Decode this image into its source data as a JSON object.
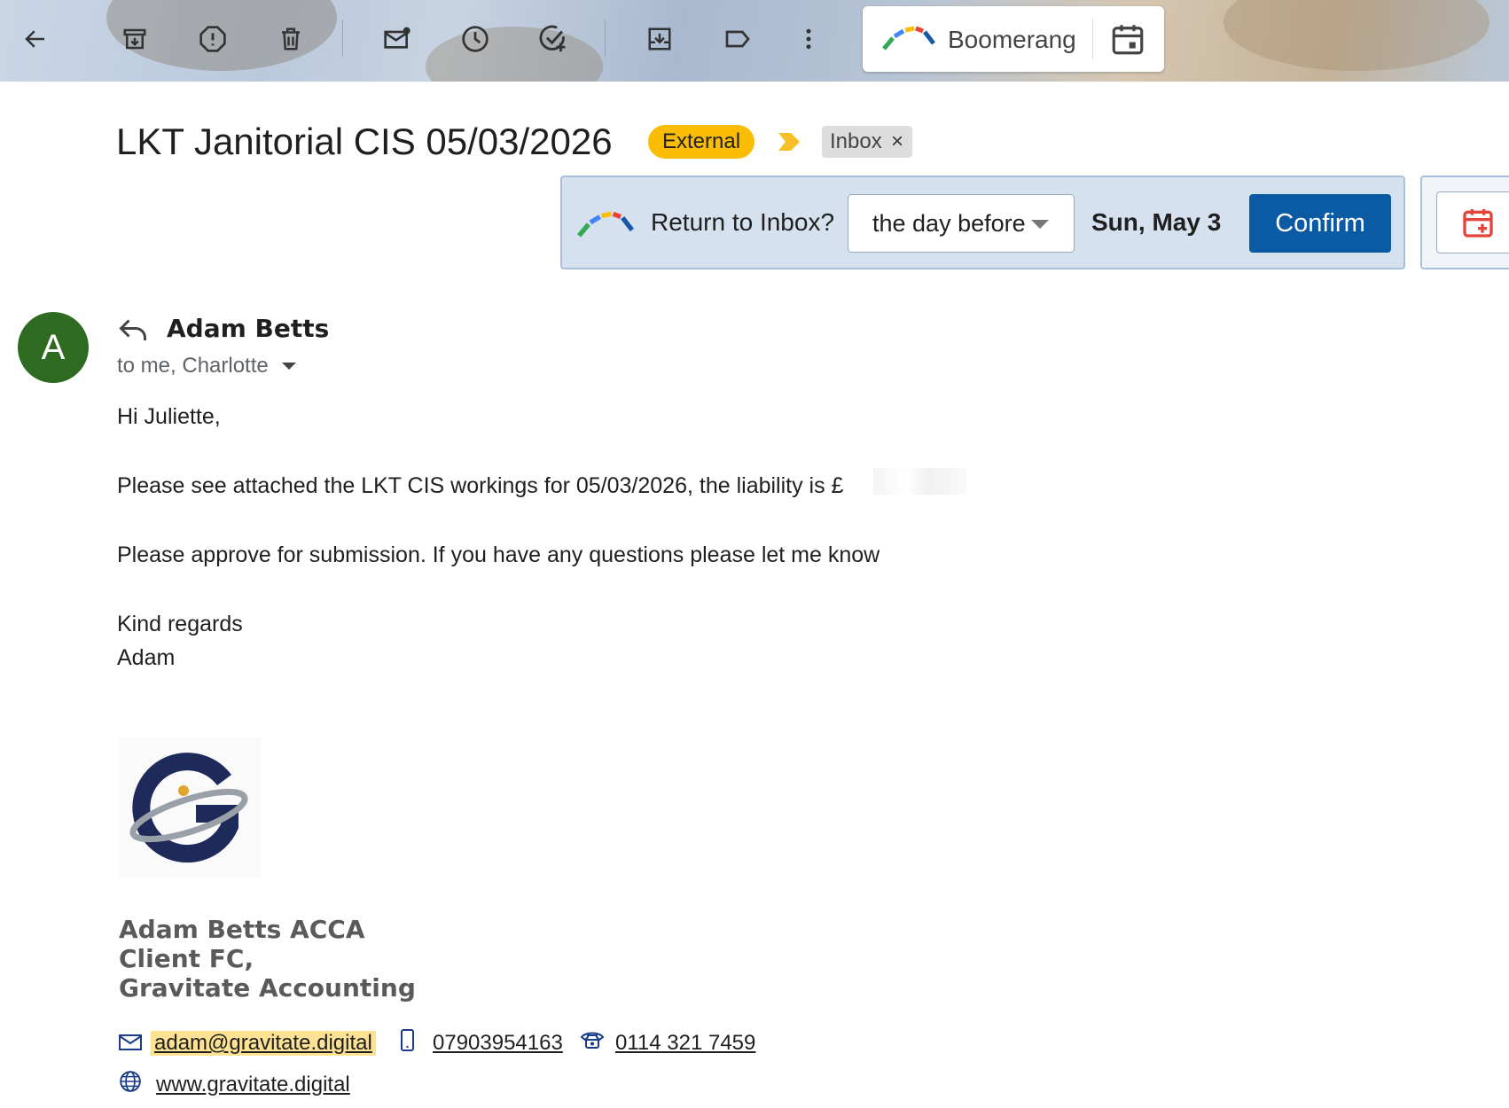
{
  "toolbar": {
    "icons": [
      "back-arrow-icon",
      "archive-icon",
      "report-spam-icon",
      "delete-icon",
      "mark-unread-icon",
      "snooze-icon",
      "add-to-tasks-icon",
      "move-to-icon",
      "label-icon",
      "more-vert-icon"
    ],
    "boomerang_label": "Boomerang"
  },
  "subject": {
    "title": "LKT Janitorial CIS 05/03/2026",
    "external_badge": "External",
    "inbox_label": "Inbox",
    "inbox_remove": "×"
  },
  "boomerang_bar": {
    "question": "Return to Inbox?",
    "selected_option": "the day before",
    "date": "Sun, May 3",
    "confirm_label": "Confirm"
  },
  "message": {
    "avatar_letter": "A",
    "sender": "Adam Betts",
    "recipients": "to me, Charlotte",
    "body": {
      "greeting": "Hi Juliette,",
      "line1": "Please see attached the LKT CIS workings for 05/03/2026, the liability is £",
      "line2": "Please approve for submission. If you have any questions please let me know",
      "closing": "Kind regards",
      "signoff": "Adam"
    }
  },
  "signature": {
    "name": "Adam Betts ACCA",
    "role": "Client FC,",
    "company": "Gravitate Accounting",
    "email": "adam@gravitate.digital",
    "mobile": "07903954163",
    "phone": "0114 321 7459",
    "website": "www.gravitate.digital"
  },
  "colors": {
    "external_badge": "#fbbc04",
    "confirm_button": "#0b5aa4",
    "avatar": "#2e6b21",
    "return_bar": "#d6e1ef",
    "email_highlight": "#fde293",
    "logo_navy": "#1e2a5a"
  }
}
